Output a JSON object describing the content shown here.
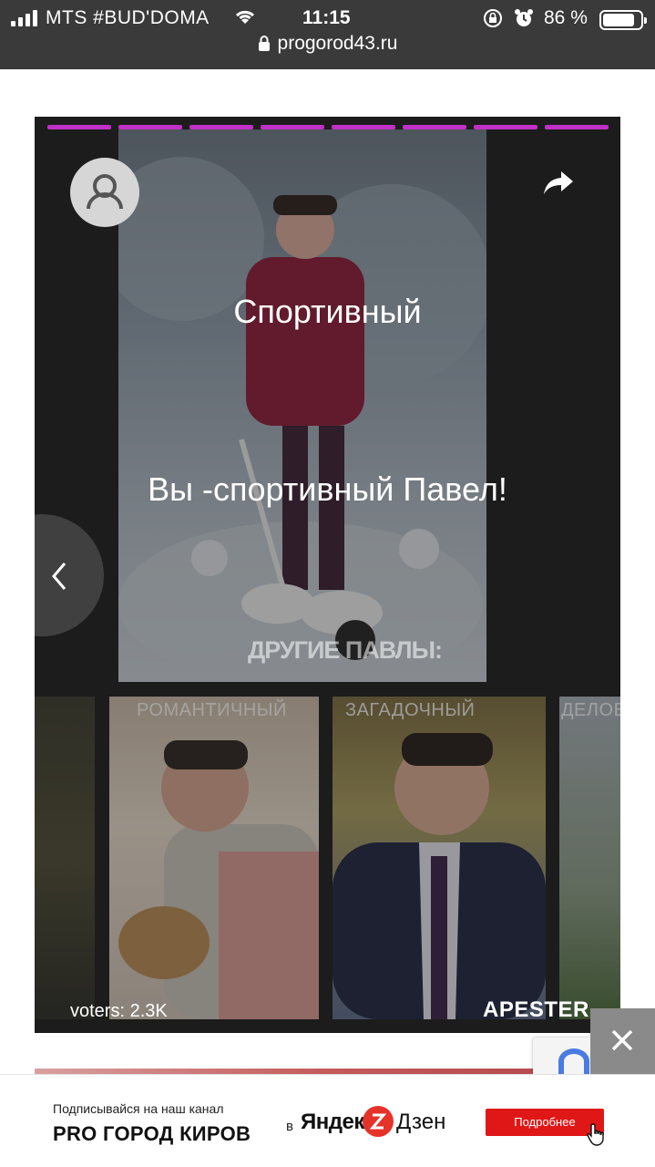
{
  "status_bar": {
    "carrier": "MTS #BUD'DOMA",
    "time": "11:15",
    "battery_percent": "86 %",
    "battery_level": 0.86
  },
  "browser": {
    "url": "progorod43.ru"
  },
  "story": {
    "progress_segments": 8,
    "accent_color": "#c12fc6",
    "title": "Спортивный",
    "result_text": "Вы -спортивный Павел!",
    "other_label": "ДРУГИЕ ПАВЛЫ:",
    "strip_labels": [
      "РОМАНТИЧНЫЙ",
      "ЗАГАДОЧНЫЙ",
      "ДЕЛОВОЙ"
    ],
    "voters": "voters: 2.3K",
    "brand": "APESTER"
  },
  "ad": {
    "subtitle": "Подписывайся на наш канал",
    "channel": "PRO ГОРОД КИРОВ",
    "in_text": "в",
    "yandex": "Яндекс",
    "zen": "Дзен",
    "button_label": "Подробнее",
    "button_color": "#e01717"
  }
}
